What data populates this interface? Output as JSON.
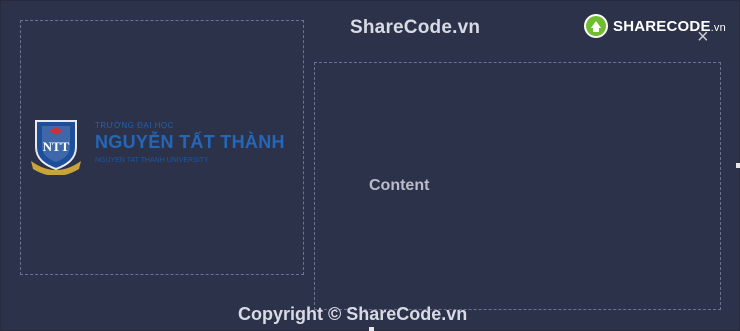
{
  "watermark": {
    "top": "ShareCode.vn",
    "bottom": "Copyright © ShareCode.vn"
  },
  "brand": {
    "name": "SHARECODE",
    "suffix": ".vn",
    "accent": "#6fbe2e"
  },
  "window": {
    "close_label": "×"
  },
  "logo": {
    "line1": "TRƯỜNG ĐẠI HỌC",
    "line2": "NGUYỄN TẤT THÀNH",
    "line3": "NGUYEN TAT THANH UNIVERSITY",
    "crest_text": "NTT",
    "color": "#2467b8"
  },
  "right_panel": {
    "content_label": "Content"
  }
}
